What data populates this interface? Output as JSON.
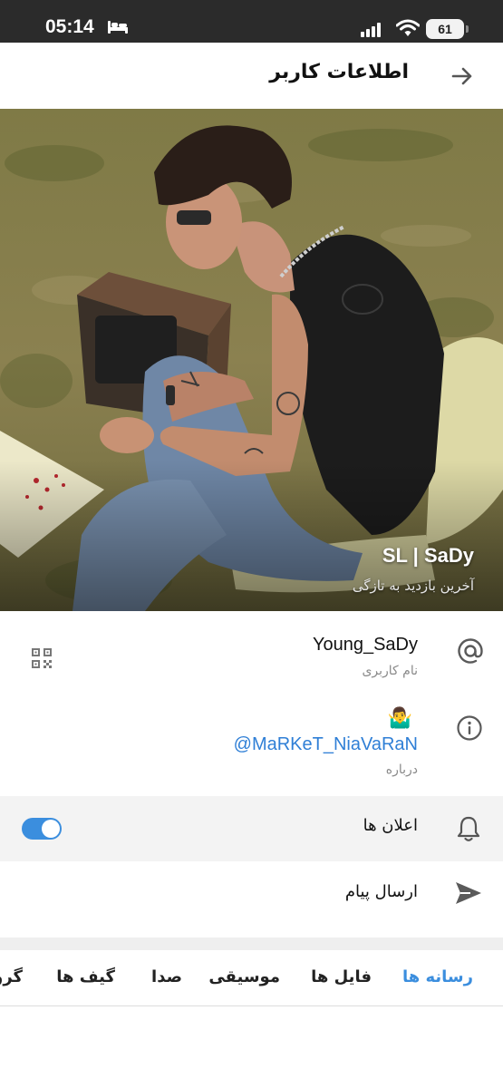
{
  "status_bar": {
    "time": "05:14",
    "battery": "61"
  },
  "header": {
    "title": "اطلاعات کاربر"
  },
  "profile": {
    "name": "SL | SaDy",
    "last_seen": "آخرین بازدید به تازگی"
  },
  "username_row": {
    "value": "Young_SaDy",
    "caption": "نام کاربری"
  },
  "about_row": {
    "emoji": "🤷‍♂️",
    "value": "@MaRKeT_NiaVaRaN",
    "caption": "درباره"
  },
  "notifications_row": {
    "label": "اعلان ها",
    "enabled": true
  },
  "send_row": {
    "label": "ارسال پیام"
  },
  "tabs": [
    {
      "label": "رسانه ها",
      "active": true
    },
    {
      "label": "فایل ها",
      "active": false
    },
    {
      "label": "موسیقی",
      "active": false
    },
    {
      "label": "صدا",
      "active": false
    },
    {
      "label": "گیف ها",
      "active": false
    },
    {
      "label": "گروه ها",
      "active": false
    }
  ],
  "colors": {
    "accent": "#3b8ede",
    "link": "#2f7fd6",
    "status_bar_bg": "#2b2b2b",
    "secondary_text": "#8a8a8a"
  }
}
